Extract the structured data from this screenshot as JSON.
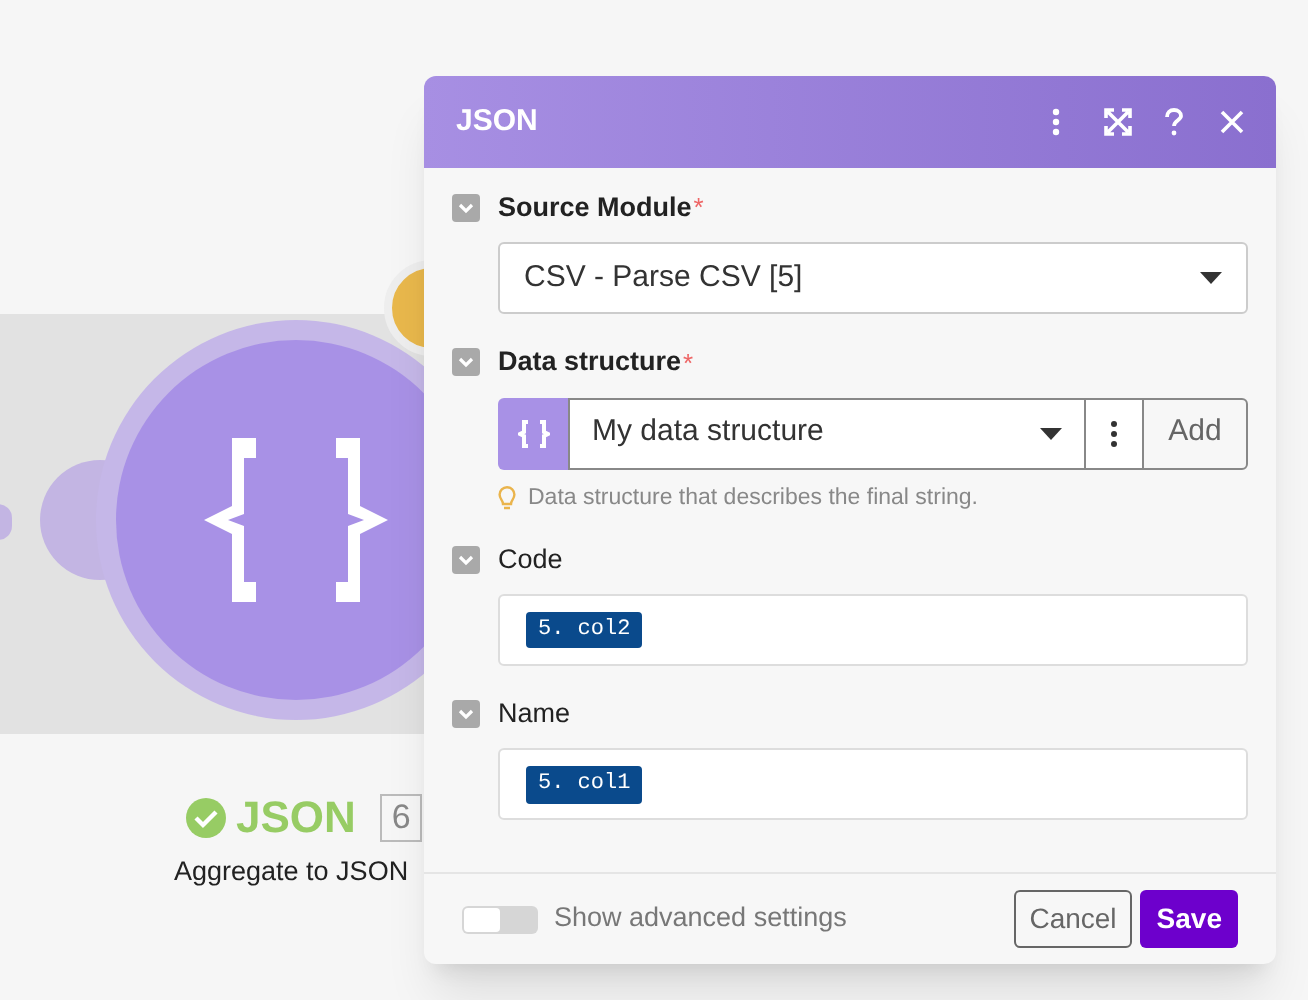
{
  "module": {
    "title": "JSON",
    "badge": "6",
    "subtitle": "Aggregate to JSON",
    "succeeded": true
  },
  "dialog": {
    "title": "JSON",
    "fields": [
      {
        "kind": "select",
        "label": "Source Module",
        "required": true,
        "required_mark": "*",
        "value": "CSV - Parse CSV [5]"
      },
      {
        "kind": "structure",
        "label": "Data structure",
        "required": true,
        "required_mark": "*",
        "value": "My data structure",
        "button": "Add",
        "hint": "Data structure that describes the final string."
      },
      {
        "kind": "mapped",
        "label": "Code",
        "required": false,
        "pill": "5. col2"
      },
      {
        "kind": "mapped",
        "label": "Name",
        "required": false,
        "pill": "5. col1"
      }
    ],
    "advanced": {
      "label": "Show advanced settings",
      "on": false
    },
    "buttons": [
      {
        "kind": "secondary",
        "label": "Cancel"
      },
      {
        "kind": "primary",
        "label": "Save"
      }
    ]
  }
}
